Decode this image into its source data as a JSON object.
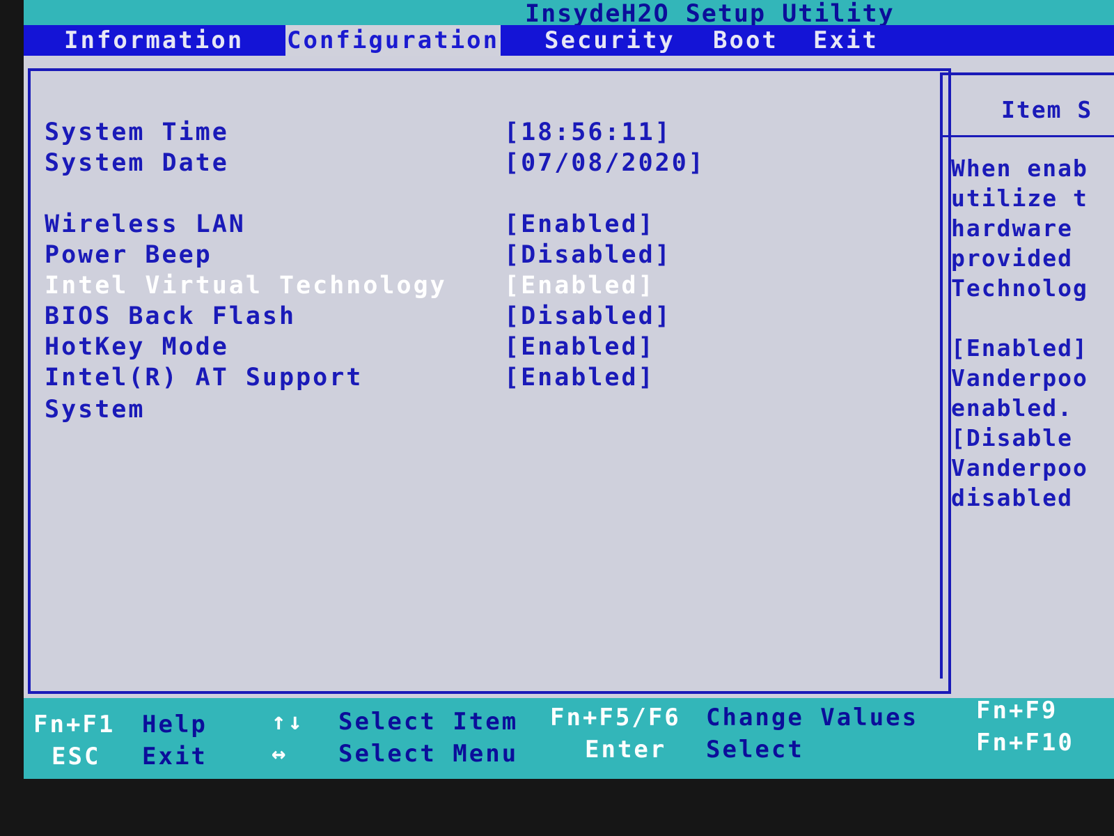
{
  "app": {
    "title": "InsydeH2O Setup Utility"
  },
  "menu": {
    "tabs": [
      {
        "label": "Information"
      },
      {
        "label": "Configuration"
      },
      {
        "label": "Security"
      },
      {
        "label": "Boot"
      },
      {
        "label": "Exit"
      }
    ],
    "active": "Configuration"
  },
  "settings": [
    {
      "label": "System Time",
      "value": "[18:56:11]"
    },
    {
      "label": "System Date",
      "value": "[07/08/2020]"
    },
    {
      "label": "Wireless LAN",
      "value": "[Enabled]"
    },
    {
      "label": "Power Beep",
      "value": "[Disabled]"
    },
    {
      "label": "Intel Virtual Technology",
      "value": "[Enabled]",
      "selected": true
    },
    {
      "label": "BIOS Back Flash",
      "value": "[Disabled]"
    },
    {
      "label": "HotKey Mode",
      "value": "[Enabled]"
    },
    {
      "label": "Intel(R) AT Support",
      "value": "[Enabled]"
    },
    {
      "label": "System",
      "value": ""
    }
  ],
  "help": {
    "title": "Item S",
    "lines": [
      "When enab",
      "utilize t",
      "hardware",
      "provided",
      "Technolog",
      "",
      "[Enabled]",
      "Vanderpoo",
      "enabled.",
      "[Disable",
      "Vanderpoo",
      "disabled"
    ]
  },
  "footer": {
    "f1_key": "Fn+F1",
    "f1_desc": "Help",
    "esc_key": "ESC",
    "esc_desc": "Exit",
    "updown_key": "↑↓",
    "updown_desc": "Select Item",
    "leftright_key": "↔",
    "leftright_desc": "Select Menu",
    "f5f6_key": "Fn+F5/F6",
    "f5f6_desc": "Change Values",
    "enter_key": "Enter",
    "enter_desc": "Select",
    "f9_key": "Fn+F9",
    "f10_key": "Fn+F10"
  },
  "colors": {
    "menu_bar": "#1414d6",
    "accent_teal": "#33b6b9",
    "panel_bg": "#cfd0dc",
    "text_blue": "#1a1ab8",
    "selected_text": "#ffffff"
  }
}
